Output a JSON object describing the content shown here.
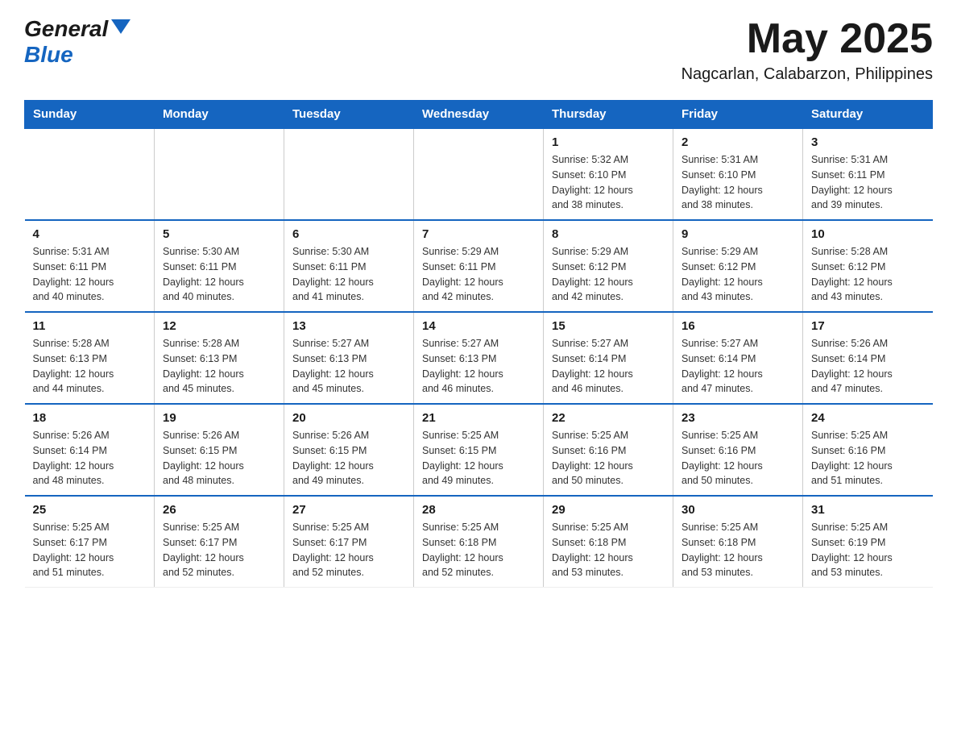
{
  "header": {
    "logo_general": "General",
    "logo_blue": "Blue",
    "month_year": "May 2025",
    "location": "Nagcarlan, Calabarzon, Philippines"
  },
  "weekdays": [
    "Sunday",
    "Monday",
    "Tuesday",
    "Wednesday",
    "Thursday",
    "Friday",
    "Saturday"
  ],
  "weeks": [
    [
      {
        "day": "",
        "info": ""
      },
      {
        "day": "",
        "info": ""
      },
      {
        "day": "",
        "info": ""
      },
      {
        "day": "",
        "info": ""
      },
      {
        "day": "1",
        "info": "Sunrise: 5:32 AM\nSunset: 6:10 PM\nDaylight: 12 hours\nand 38 minutes."
      },
      {
        "day": "2",
        "info": "Sunrise: 5:31 AM\nSunset: 6:10 PM\nDaylight: 12 hours\nand 38 minutes."
      },
      {
        "day": "3",
        "info": "Sunrise: 5:31 AM\nSunset: 6:11 PM\nDaylight: 12 hours\nand 39 minutes."
      }
    ],
    [
      {
        "day": "4",
        "info": "Sunrise: 5:31 AM\nSunset: 6:11 PM\nDaylight: 12 hours\nand 40 minutes."
      },
      {
        "day": "5",
        "info": "Sunrise: 5:30 AM\nSunset: 6:11 PM\nDaylight: 12 hours\nand 40 minutes."
      },
      {
        "day": "6",
        "info": "Sunrise: 5:30 AM\nSunset: 6:11 PM\nDaylight: 12 hours\nand 41 minutes."
      },
      {
        "day": "7",
        "info": "Sunrise: 5:29 AM\nSunset: 6:11 PM\nDaylight: 12 hours\nand 42 minutes."
      },
      {
        "day": "8",
        "info": "Sunrise: 5:29 AM\nSunset: 6:12 PM\nDaylight: 12 hours\nand 42 minutes."
      },
      {
        "day": "9",
        "info": "Sunrise: 5:29 AM\nSunset: 6:12 PM\nDaylight: 12 hours\nand 43 minutes."
      },
      {
        "day": "10",
        "info": "Sunrise: 5:28 AM\nSunset: 6:12 PM\nDaylight: 12 hours\nand 43 minutes."
      }
    ],
    [
      {
        "day": "11",
        "info": "Sunrise: 5:28 AM\nSunset: 6:13 PM\nDaylight: 12 hours\nand 44 minutes."
      },
      {
        "day": "12",
        "info": "Sunrise: 5:28 AM\nSunset: 6:13 PM\nDaylight: 12 hours\nand 45 minutes."
      },
      {
        "day": "13",
        "info": "Sunrise: 5:27 AM\nSunset: 6:13 PM\nDaylight: 12 hours\nand 45 minutes."
      },
      {
        "day": "14",
        "info": "Sunrise: 5:27 AM\nSunset: 6:13 PM\nDaylight: 12 hours\nand 46 minutes."
      },
      {
        "day": "15",
        "info": "Sunrise: 5:27 AM\nSunset: 6:14 PM\nDaylight: 12 hours\nand 46 minutes."
      },
      {
        "day": "16",
        "info": "Sunrise: 5:27 AM\nSunset: 6:14 PM\nDaylight: 12 hours\nand 47 minutes."
      },
      {
        "day": "17",
        "info": "Sunrise: 5:26 AM\nSunset: 6:14 PM\nDaylight: 12 hours\nand 47 minutes."
      }
    ],
    [
      {
        "day": "18",
        "info": "Sunrise: 5:26 AM\nSunset: 6:14 PM\nDaylight: 12 hours\nand 48 minutes."
      },
      {
        "day": "19",
        "info": "Sunrise: 5:26 AM\nSunset: 6:15 PM\nDaylight: 12 hours\nand 48 minutes."
      },
      {
        "day": "20",
        "info": "Sunrise: 5:26 AM\nSunset: 6:15 PM\nDaylight: 12 hours\nand 49 minutes."
      },
      {
        "day": "21",
        "info": "Sunrise: 5:25 AM\nSunset: 6:15 PM\nDaylight: 12 hours\nand 49 minutes."
      },
      {
        "day": "22",
        "info": "Sunrise: 5:25 AM\nSunset: 6:16 PM\nDaylight: 12 hours\nand 50 minutes."
      },
      {
        "day": "23",
        "info": "Sunrise: 5:25 AM\nSunset: 6:16 PM\nDaylight: 12 hours\nand 50 minutes."
      },
      {
        "day": "24",
        "info": "Sunrise: 5:25 AM\nSunset: 6:16 PM\nDaylight: 12 hours\nand 51 minutes."
      }
    ],
    [
      {
        "day": "25",
        "info": "Sunrise: 5:25 AM\nSunset: 6:17 PM\nDaylight: 12 hours\nand 51 minutes."
      },
      {
        "day": "26",
        "info": "Sunrise: 5:25 AM\nSunset: 6:17 PM\nDaylight: 12 hours\nand 52 minutes."
      },
      {
        "day": "27",
        "info": "Sunrise: 5:25 AM\nSunset: 6:17 PM\nDaylight: 12 hours\nand 52 minutes."
      },
      {
        "day": "28",
        "info": "Sunrise: 5:25 AM\nSunset: 6:18 PM\nDaylight: 12 hours\nand 52 minutes."
      },
      {
        "day": "29",
        "info": "Sunrise: 5:25 AM\nSunset: 6:18 PM\nDaylight: 12 hours\nand 53 minutes."
      },
      {
        "day": "30",
        "info": "Sunrise: 5:25 AM\nSunset: 6:18 PM\nDaylight: 12 hours\nand 53 minutes."
      },
      {
        "day": "31",
        "info": "Sunrise: 5:25 AM\nSunset: 6:19 PM\nDaylight: 12 hours\nand 53 minutes."
      }
    ]
  ]
}
